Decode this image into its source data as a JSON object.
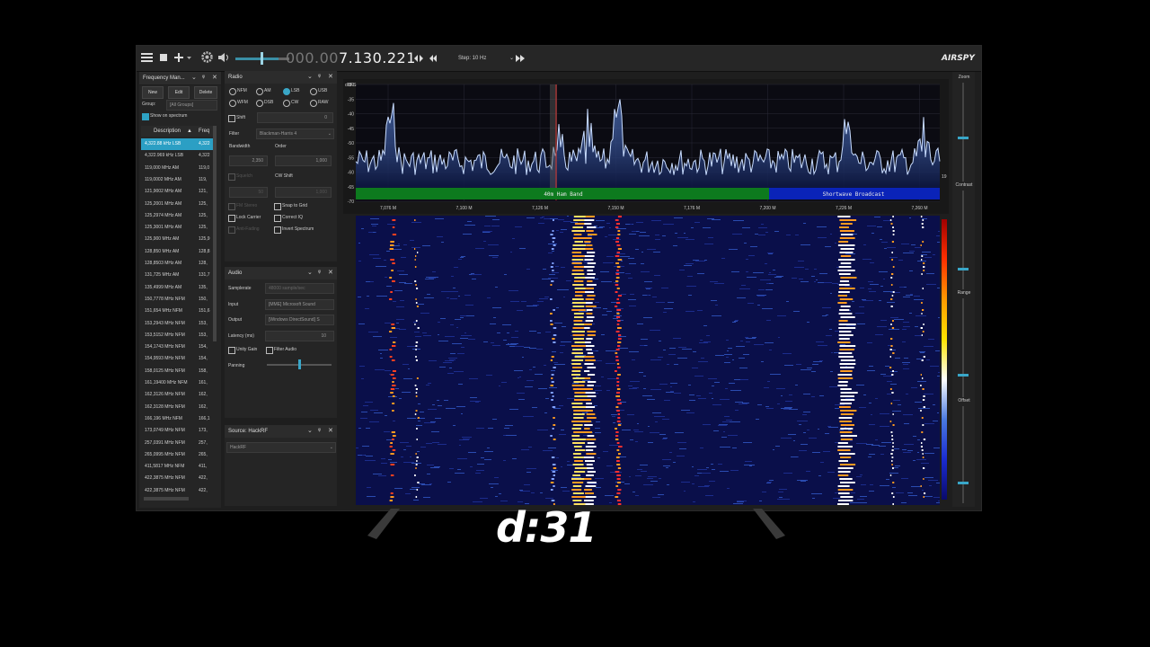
{
  "toolbar": {
    "menu_icon": "hamburger-menu-icon",
    "stop_icon": "stop-icon",
    "add_icon": "plus-icon",
    "settings_icon": "gear-icon",
    "volume_icon": "speaker-icon",
    "vfo_dim": "000.00",
    "vfo_lit": "7.130.221",
    "step_label": "Step: 10 Hz",
    "logo": "AIRSPY"
  },
  "freq_manager": {
    "title": "Frequency Man...",
    "new_label": "New",
    "edit_label": "Edit",
    "delete_label": "Delete",
    "group_label": "Group:",
    "group_value": "[All Groups]",
    "show_on_spectrum": "Show on spectrum",
    "col_description": "Description",
    "col_freq": "Freq",
    "rows": [
      {
        "d": "4,322.88 kHz LSB",
        "f": "4,322"
      },
      {
        "d": "4,322.969 kHz LSB",
        "f": "4,322"
      },
      {
        "d": "119,000 MHz AM",
        "f": "119,0"
      },
      {
        "d": "119,0002 MHz AM",
        "f": "119,"
      },
      {
        "d": "121,9002 MHz AM",
        "f": "121,"
      },
      {
        "d": "125,2001 MHz AM",
        "f": "125,"
      },
      {
        "d": "125,2974 MHz AM",
        "f": "125,"
      },
      {
        "d": "125,3001 MHz AM",
        "f": "125,"
      },
      {
        "d": "125,900 MHz AM",
        "f": "125,9"
      },
      {
        "d": "128,850 MHz AM",
        "f": "128,8"
      },
      {
        "d": "128,8503 MHz AM",
        "f": "128,"
      },
      {
        "d": "131,725 MHz AM",
        "f": "131,7"
      },
      {
        "d": "135,4999 MHz AM",
        "f": "135,"
      },
      {
        "d": "150,7778 MHz NFM",
        "f": "150,"
      },
      {
        "d": "151,654 MHz NFM",
        "f": "151,6"
      },
      {
        "d": "153,2943 MHz NFM",
        "f": "153,"
      },
      {
        "d": "153,5152 MHz NFM",
        "f": "153,"
      },
      {
        "d": "154,1743 MHz NFM",
        "f": "154,"
      },
      {
        "d": "154,9593 MHz NFM",
        "f": "154,"
      },
      {
        "d": "158,0125 MHz NFM",
        "f": "158,"
      },
      {
        "d": "161,19400 MHz NFM",
        "f": "161,"
      },
      {
        "d": "162,3126 MHz NFM",
        "f": "162,"
      },
      {
        "d": "162,3128 MHz NFM",
        "f": "162,"
      },
      {
        "d": "166,196 MHz NFM",
        "f": "166,1"
      },
      {
        "d": "173,0749 MHz NFM",
        "f": "173,"
      },
      {
        "d": "257,0391 MHz NFM",
        "f": "257,"
      },
      {
        "d": "265,0995 MHz NFM",
        "f": "265,"
      },
      {
        "d": "411,5817 MHz NFM",
        "f": "411,"
      },
      {
        "d": "422,3875 MHz NFM",
        "f": "422,"
      },
      {
        "d": "422,3875 MHz NFM",
        "f": "422,"
      }
    ]
  },
  "radio": {
    "title": "Radio",
    "modes_row1": [
      "NFM",
      "AM",
      "LSB",
      "USB"
    ],
    "modes_row2": [
      "WFM",
      "DSB",
      "CW",
      "RAW"
    ],
    "selected_mode": "LSB",
    "shift_label": "Shift",
    "shift_value": "0",
    "filter_label": "Filter",
    "filter_value": "Blackman-Harris 4",
    "bandwidth_label": "Bandwidth",
    "order_label": "Order",
    "bandwidth_value": "2,350",
    "order_value": "1,000",
    "squelch_label": "Squelch",
    "cw_shift_label": "CW Shift",
    "squelch_value": "50",
    "cw_shift_value": "1,000",
    "fm_stereo": "FM Stereo",
    "snap_to_grid": "Snap to Grid",
    "lock_carrier": "Lock Carrier",
    "correct_iq": "Correct IQ",
    "anti_fading": "Anti-Fading",
    "invert_spectrum": "Invert Spectrum"
  },
  "audio": {
    "title": "Audio",
    "samplerate_label": "Samplerate",
    "samplerate_value": "48000 sample/sec",
    "input_label": "Input",
    "input_value": "[MME] Microsoft Sound",
    "output_label": "Output",
    "output_value": "[Windows DirectSound] S",
    "latency_label": "Latency (ms)",
    "latency_value": "10",
    "unity_gain": "Unity Gain",
    "filter_audio": "Filter Audio",
    "panning_label": "Panning"
  },
  "source": {
    "title": "Source: HackRF",
    "value": "HackRF"
  },
  "spectrum": {
    "unit_label": "dBFS",
    "y_ticks": [
      "-30",
      "-35",
      "-40",
      "-45",
      "-50",
      "-55",
      "-60",
      "-65",
      "-70"
    ],
    "x_ticks": [
      "7,076 M",
      "7,100 M",
      "7,126 M",
      "7,150 M",
      "7,176 M",
      "7,200 M",
      "7,226 M",
      "7,260 M"
    ],
    "band_ham": "40m Ham Band",
    "band_sw": "Shortwave Broadcast",
    "ham_color": "#0d7a1e",
    "sw_color": "#0a23b8",
    "trace_color": "#c8dcff",
    "side_value": "19"
  },
  "side_controls": {
    "zoom": "Zoom",
    "contrast": "Contrast",
    "range": "Range",
    "offset": "Offset"
  },
  "overlay": {
    "clock": "d:31"
  }
}
